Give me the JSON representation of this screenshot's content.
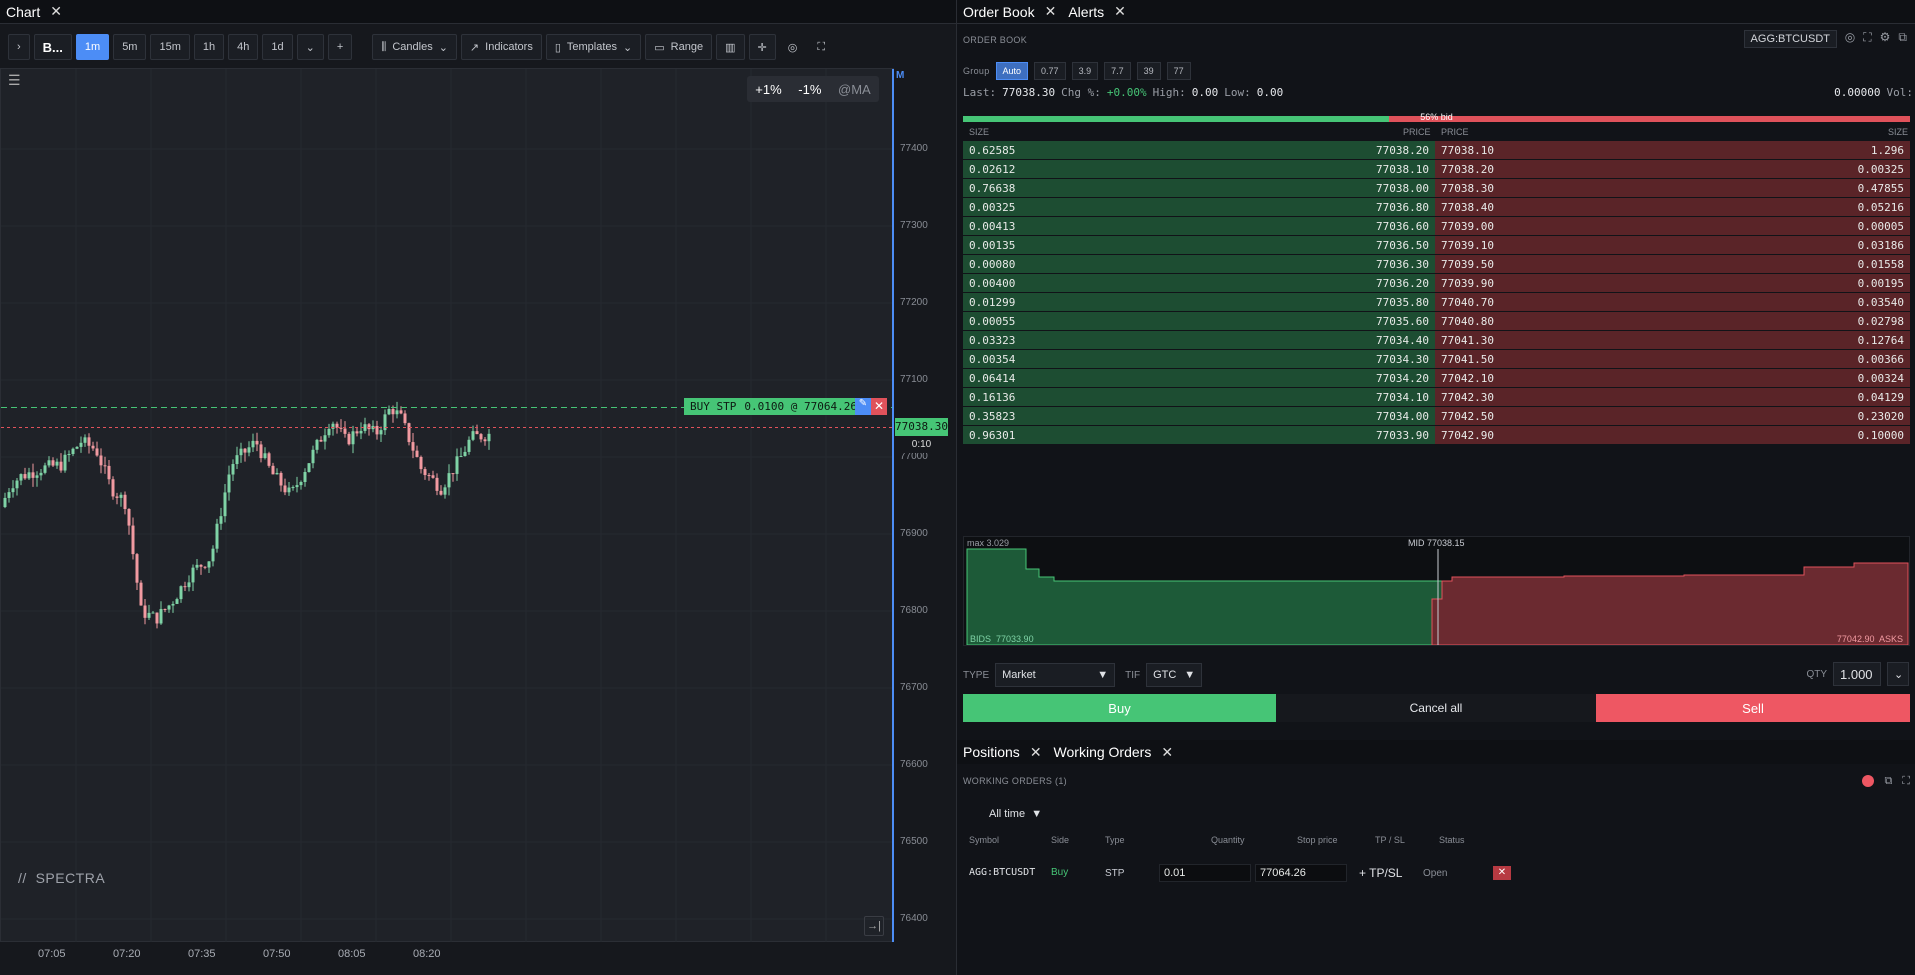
{
  "chart_tab": {
    "title": "Chart"
  },
  "toolbar": {
    "symbol": "B...",
    "intervals": [
      "1m",
      "5m",
      "15m",
      "1h",
      "4h",
      "1d"
    ],
    "active_interval": "1m",
    "plus": "+",
    "candles": "Candles",
    "indicators": "Indicators",
    "templates": "Templates",
    "range": "Range"
  },
  "chart": {
    "pct_up": "+1%",
    "pct_down": "-1%",
    "ma": "@MA",
    "logo": "SPECTRA",
    "m_marker": "M",
    "order_label_side": "BUY STP",
    "order_label_text": "0.0100 @ 77064.26",
    "order_price": 77064.26,
    "last_price": "77038.30",
    "last_price_value": 77038.3,
    "countdown": "0:10",
    "y_ticks": [
      "77400",
      "77300",
      "77200",
      "77100",
      "77000",
      "76900",
      "76800",
      "76700",
      "76600",
      "76500",
      "76400"
    ],
    "x_ticks": [
      "07:05",
      "07:20",
      "07:35",
      "07:50",
      "08:05",
      "08:20"
    ],
    "colors": {
      "up": "#7fd3a6",
      "down": "#f19aa1",
      "order_line": "#46c576",
      "last_line": "#e0525b"
    }
  },
  "right_tabs": {
    "order_book": "Order Book",
    "alerts": "Alerts"
  },
  "order_book": {
    "section_label": "ORDER BOOK",
    "symbol": "AGG:BTCUSDT",
    "group_label": "Group",
    "groups": [
      "Auto",
      "0.77",
      "3.9",
      "7.7",
      "39",
      "77"
    ],
    "active_group": "Auto",
    "stats": {
      "last_label": "Last:",
      "last": "77038.30",
      "chg_label": "Chg %:",
      "chg": "+0.00%",
      "high_label": "High:",
      "high": "0.00",
      "low_label": "Low:",
      "low": "0.00",
      "vol": "0.00000",
      "vol_label": "Vol:"
    },
    "bid_ratio_text": "56% bid",
    "bid_ratio": 0.45,
    "headers": {
      "size": "SIZE",
      "price": "PRICE"
    },
    "bids": [
      [
        "0.62585",
        "77038.20"
      ],
      [
        "0.02612",
        "77038.10"
      ],
      [
        "0.76638",
        "77038.00"
      ],
      [
        "0.00325",
        "77036.80"
      ],
      [
        "0.00413",
        "77036.60"
      ],
      [
        "0.00135",
        "77036.50"
      ],
      [
        "0.00080",
        "77036.30"
      ],
      [
        "0.00400",
        "77036.20"
      ],
      [
        "0.01299",
        "77035.80"
      ],
      [
        "0.00055",
        "77035.60"
      ],
      [
        "0.03323",
        "77034.40"
      ],
      [
        "0.00354",
        "77034.30"
      ],
      [
        "0.06414",
        "77034.20"
      ],
      [
        "0.16136",
        "77034.10"
      ],
      [
        "0.35823",
        "77034.00"
      ],
      [
        "0.96301",
        "77033.90"
      ]
    ],
    "asks": [
      [
        "77038.10",
        "1.296"
      ],
      [
        "77038.20",
        "0.00325"
      ],
      [
        "77038.30",
        "0.47855"
      ],
      [
        "77038.40",
        "0.05216"
      ],
      [
        "77039.00",
        "0.00005"
      ],
      [
        "77039.10",
        "0.03186"
      ],
      [
        "77039.50",
        "0.01558"
      ],
      [
        "77039.90",
        "0.00195"
      ],
      [
        "77040.70",
        "0.03540"
      ],
      [
        "77040.80",
        "0.02798"
      ],
      [
        "77041.30",
        "0.12764"
      ],
      [
        "77041.50",
        "0.00366"
      ],
      [
        "77042.10",
        "0.00324"
      ],
      [
        "77042.30",
        "0.04129"
      ],
      [
        "77042.50",
        "0.23020"
      ],
      [
        "77042.90",
        "0.10000"
      ]
    ]
  },
  "depth": {
    "max_label": "max 3.029",
    "mid_label": "MID 77038.15",
    "bids_label": "BIDS",
    "bids_price": "77033.90",
    "asks_price": "77042.90",
    "asks_label": "ASKS"
  },
  "order_entry": {
    "type_label": "TYPE",
    "type_value": "Market",
    "tif_label": "TIF",
    "tif_value": "GTC",
    "qty_label": "QTY",
    "qty_value": "1.000",
    "buy": "Buy",
    "cancel_all": "Cancel all",
    "sell": "Sell"
  },
  "bottom_tabs": {
    "positions": "Positions",
    "working_orders": "Working Orders"
  },
  "working_orders": {
    "section_label": "WORKING ORDERS",
    "count": "(1)",
    "filter": "All time",
    "columns": [
      "Symbol",
      "Side",
      "Type",
      "Quantity",
      "Stop price",
      "TP / SL",
      "Status"
    ],
    "row": {
      "symbol": "AGG:BTCUSDT",
      "side": "Buy",
      "type": "STP",
      "quantity": "0.01",
      "stop_price": "77064.26",
      "tpsl": "+ TP/SL",
      "status": "Open"
    }
  }
}
